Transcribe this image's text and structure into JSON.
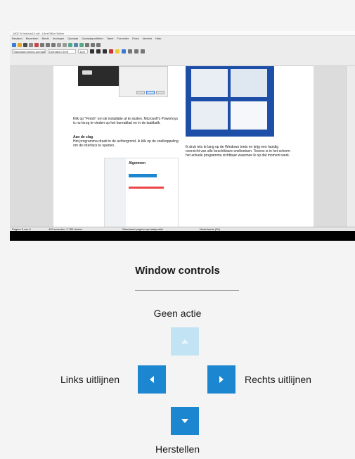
{
  "screenshot": {
    "window_title": "1802 W indows10.odt - LibreOffice Writer",
    "menu": [
      "Bestand",
      "Bewerken",
      "Beeld",
      "Invoegen",
      "Opmaak",
      "Opmaakprofielen",
      "Tabel",
      "Formulier",
      "Extra",
      "Venster",
      "Help"
    ],
    "style_box": "Standaard Alinea-opmaak",
    "font_box": "Liberation Serif",
    "size_box": "12pt",
    "doc": {
      "para1": "Klik op \"Finish\" om de installatie af te sluiten. Microsoft's Powertoys is nu terug te vinden op het bureablad en in de taakbalk.",
      "heading2": "Aan de slag",
      "para2": "Het programma draait in de achtergrond, ik klik op de snelkoppeling om de interface te openen.",
      "para3": "Ik druk iets te lang op de Windows toets en krijg een handig overzicht van alle beschikbare sneltoetsen. Tevens is in het scherm het actuele programma zichtbaar waarmee ik op dat moment werk.",
      "settings_title": "Algemeen"
    },
    "status": [
      "Pagina 5 van 6",
      "403 woorden, 2.789 tekens",
      "Standaard pagina-opmaakprofiel",
      "Nederlands (NL)"
    ]
  },
  "panel": {
    "title": "Window controls",
    "top_label": "Geen actie",
    "left_label": "Links uitlijnen",
    "right_label": "Rechts uitlijnen",
    "bottom_label": "Herstellen"
  },
  "colors": {
    "key_active": "#1c87d0",
    "key_disabled": "#c2e3f3"
  }
}
